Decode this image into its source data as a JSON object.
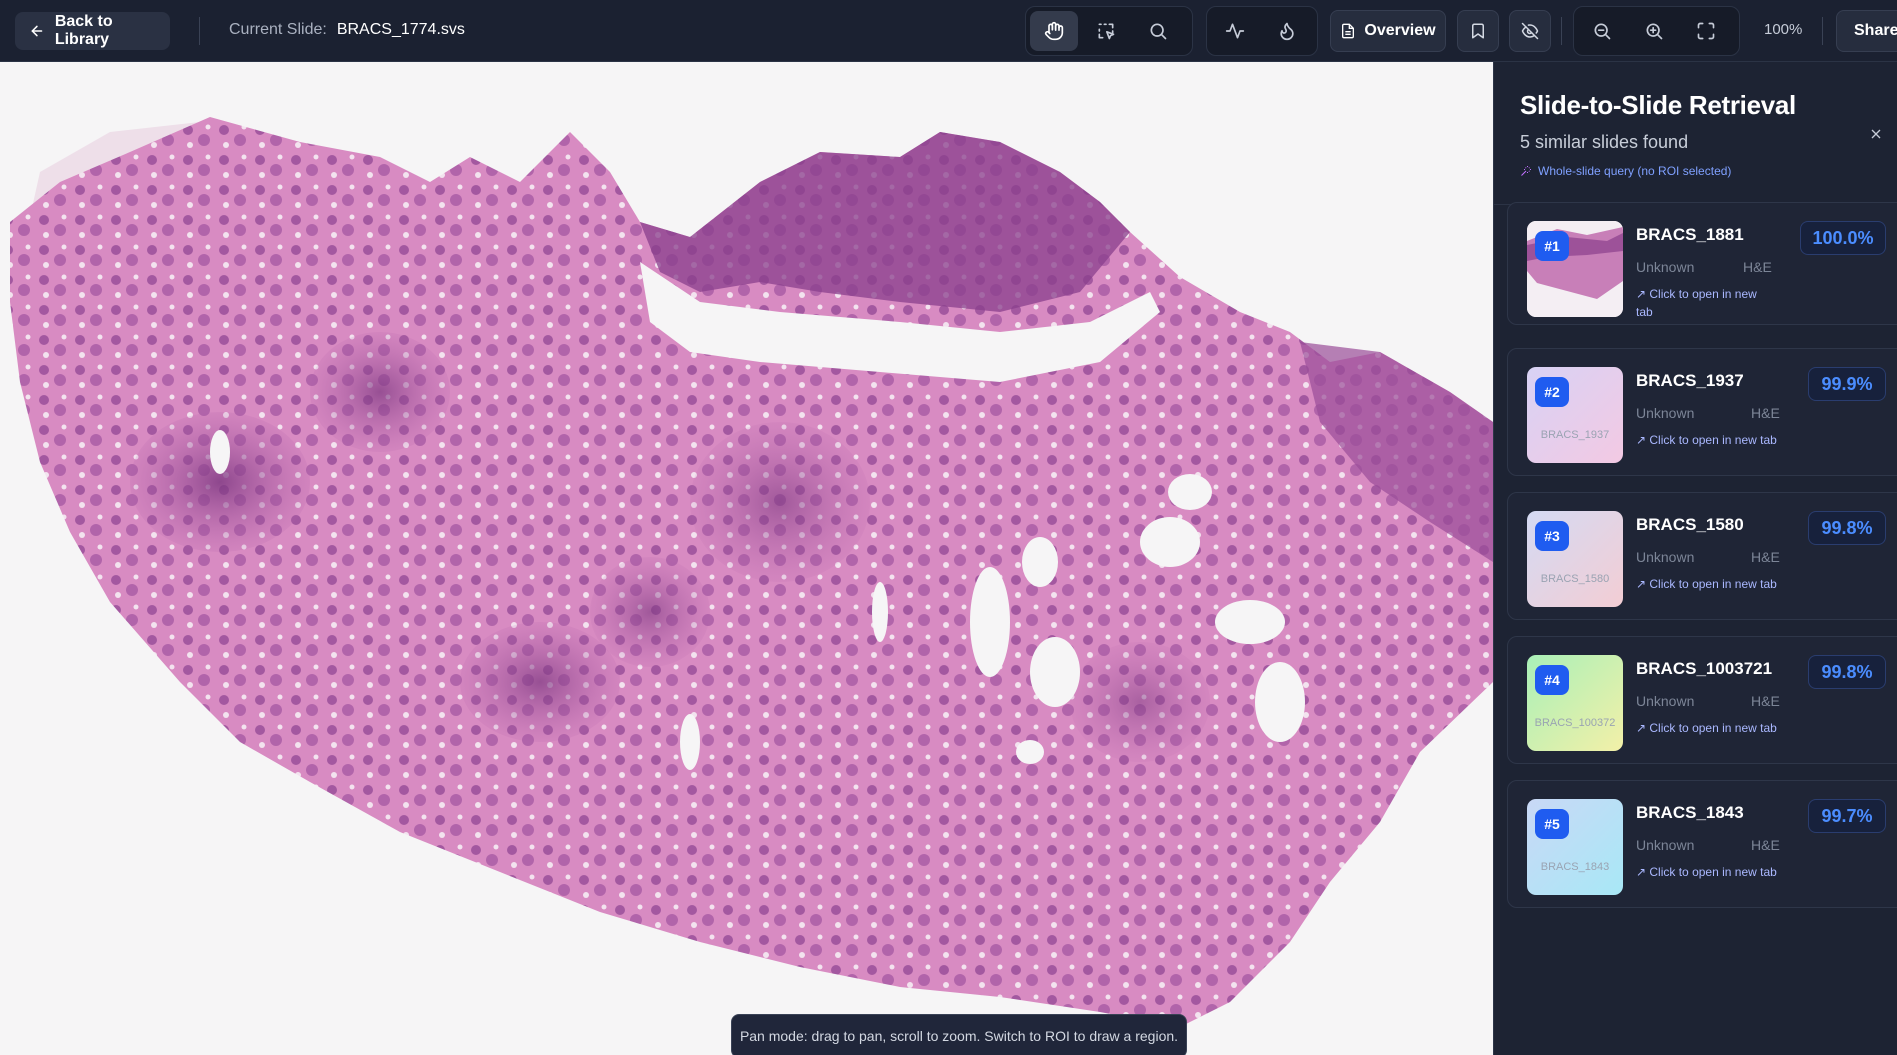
{
  "topbar": {
    "back_label": "Back to Library",
    "current_slide_label": "Current Slide:",
    "current_slide_value": "BRACS_1774.svs",
    "overview_label": "Overview",
    "zoom_level": "100%",
    "share_label": "Share"
  },
  "viewer": {
    "toast": "Pan mode: drag to pan, scroll to zoom. Switch to ROI to draw a region."
  },
  "panel": {
    "title": "Slide-to-Slide Retrieval",
    "subtitle": "5 similar slides found",
    "query_note": "Whole-slide query (no ROI selected)",
    "results": [
      {
        "rank": "#1",
        "name": "BRACS_1881",
        "diagnosis": "Unknown",
        "stain": "H&E",
        "link": "Click to open in new tab",
        "score": "100.0%",
        "thumb_label": ""
      },
      {
        "rank": "#2",
        "name": "BRACS_1937",
        "diagnosis": "Unknown",
        "stain": "H&E",
        "link": "Click to open in new tab",
        "score": "99.9%",
        "thumb_label": "BRACS_1937"
      },
      {
        "rank": "#3",
        "name": "BRACS_1580",
        "diagnosis": "Unknown",
        "stain": "H&E",
        "link": "Click to open in new tab",
        "score": "99.8%",
        "thumb_label": "BRACS_1580"
      },
      {
        "rank": "#4",
        "name": "BRACS_1003721",
        "diagnosis": "Unknown",
        "stain": "H&E",
        "link": "Click to open in new tab",
        "score": "99.8%",
        "thumb_label": "BRACS_100372"
      },
      {
        "rank": "#5",
        "name": "BRACS_1843",
        "diagnosis": "Unknown",
        "stain": "H&E",
        "link": "Click to open in new tab",
        "score": "99.7%",
        "thumb_label": "BRACS_1843"
      }
    ]
  },
  "colors": {
    "accent": "#1f5cf0",
    "score_text": "#4b8dff",
    "tissue_pink": "#d98cc4",
    "tissue_purple": "#8a3f8c"
  }
}
